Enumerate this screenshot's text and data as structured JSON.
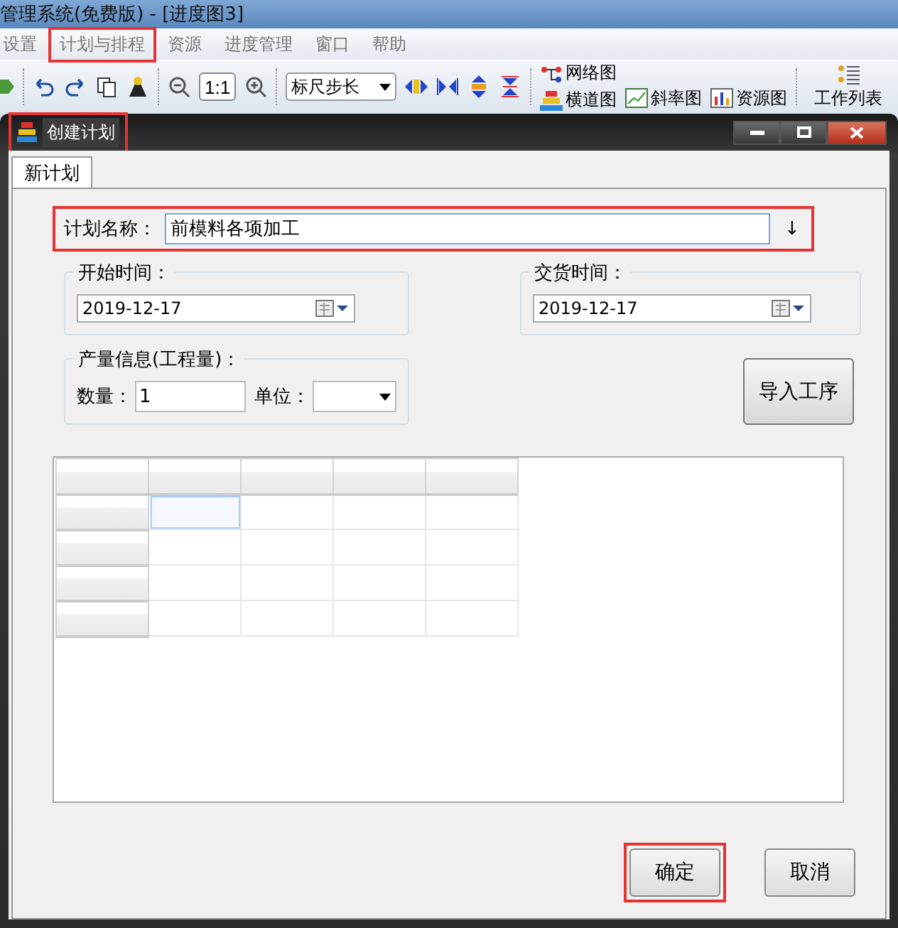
{
  "app_title": "管理系统(免费版) - [进度图3]",
  "menu": [
    {
      "label": "设置",
      "highlighted": false
    },
    {
      "label": "计划与排程",
      "highlighted": true
    },
    {
      "label": "资源",
      "highlighted": false
    },
    {
      "label": "进度管理",
      "highlighted": false
    },
    {
      "label": "窗口",
      "highlighted": false
    },
    {
      "label": "帮助",
      "highlighted": false
    }
  ],
  "toolbar": {
    "zoom_reset": "1:1",
    "ruler_step": "标尺步长",
    "network": "网络图",
    "gantt": "横道图",
    "slope": "斜率图",
    "resource": "资源图",
    "worklist": "工作列表"
  },
  "dialog": {
    "title": "创建计划",
    "title_highlighted": true,
    "tabs": [
      {
        "label": "新计划",
        "selected": true
      }
    ],
    "plan_name": {
      "label": "计划名称：",
      "value": "前模料各项加工",
      "arrow": "↓",
      "highlighted": true
    },
    "start": {
      "legend": "开始时间：",
      "value": "2019-12-17"
    },
    "delivery": {
      "legend": "交货时间：",
      "value": "2019-12-17"
    },
    "output": {
      "legend": "产量信息(工程量)：",
      "quantity_label": "数量：",
      "quantity": "1",
      "unit_label": "单位："
    },
    "import_button": "导入工序",
    "grid": {
      "rows": [
        {
          "cells": [
            {
              "selected": true
            },
            {
              "selected": false
            },
            {
              "selected": false
            },
            {
              "selected": false
            }
          ]
        },
        {
          "cells": [
            {
              "selected": false
            },
            {
              "selected": false
            },
            {
              "selected": false
            },
            {
              "selected": false
            }
          ]
        },
        {
          "cells": [
            {
              "selected": false
            },
            {
              "selected": false
            },
            {
              "selected": false
            },
            {
              "selected": false
            }
          ]
        },
        {
          "cells": [
            {
              "selected": false
            },
            {
              "selected": false
            },
            {
              "selected": false
            },
            {
              "selected": false
            }
          ]
        }
      ]
    },
    "buttons": [
      {
        "label": "确定",
        "highlighted": true
      },
      {
        "label": "取消",
        "highlighted": false
      }
    ]
  }
}
